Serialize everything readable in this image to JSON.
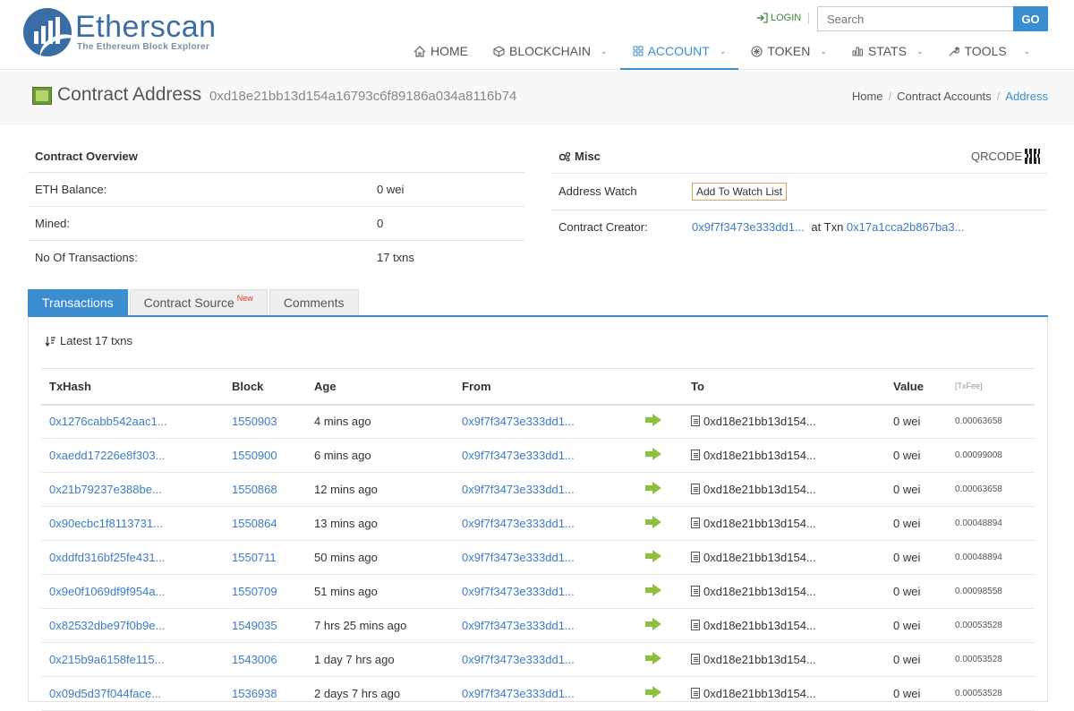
{
  "header": {
    "logo_title": "Etherscan",
    "logo_subtitle": "The Ethereum Block Explorer",
    "login_label": "LOGIN",
    "search_placeholder": "Search",
    "go_label": "GO",
    "nav": [
      {
        "label": "HOME",
        "icon": "home-icon"
      },
      {
        "label": "BLOCKCHAIN",
        "icon": "cube-icon"
      },
      {
        "label": "ACCOUNT",
        "icon": "grid-icon",
        "active": true
      },
      {
        "label": "TOKEN",
        "icon": "token-icon"
      },
      {
        "label": "STATS",
        "icon": "bar-chart-icon"
      },
      {
        "label": "TOOLS",
        "icon": "wrench-icon"
      }
    ]
  },
  "page": {
    "title": "Contract Address",
    "address": "0xd18e21bb13d154a16793c6f89186a034a8116b74",
    "breadcrumb": [
      "Home",
      "Contract Accounts",
      "Address"
    ]
  },
  "overview": {
    "title": "Contract Overview",
    "rows": [
      {
        "key": "ETH Balance:",
        "value": "0 wei"
      },
      {
        "key": "Mined:",
        "value": "0"
      },
      {
        "key": "No Of Transactions:",
        "value": "17 txns"
      }
    ]
  },
  "misc": {
    "title": "Misc",
    "qrcode_label": "QRCODE",
    "address_watch_label": "Address Watch",
    "watch_button": "Add To Watch List",
    "creator_label": "Contract Creator:",
    "creator_address": "0x9f7f3473e333dd1...",
    "at_txn_label": "at Txn",
    "creator_txn": "0x17a1cca2b867ba3..."
  },
  "tabs": {
    "transactions": "Transactions",
    "contract_source": "Contract Source",
    "new_badge": "New",
    "comments": "Comments"
  },
  "transactions": {
    "summary": "Latest 17 txns",
    "columns": [
      "TxHash",
      "Block",
      "Age",
      "From",
      "To",
      "Value",
      "[TxFee]"
    ],
    "rows": [
      {
        "hash": "0x1276cabb542aac1...",
        "block": "1550903",
        "age": "4 mins ago",
        "from": "0x9f7f3473e333dd1...",
        "to": "0xd18e21bb13d154...",
        "value": "0 wei",
        "fee": "0.00063658"
      },
      {
        "hash": "0xaedd17226e8f303...",
        "block": "1550900",
        "age": "6 mins ago",
        "from": "0x9f7f3473e333dd1...",
        "to": "0xd18e21bb13d154...",
        "value": "0 wei",
        "fee": "0.00099008"
      },
      {
        "hash": "0x21b79237e388be...",
        "block": "1550868",
        "age": "12 mins ago",
        "from": "0x9f7f3473e333dd1...",
        "to": "0xd18e21bb13d154...",
        "value": "0 wei",
        "fee": "0.00063658"
      },
      {
        "hash": "0x90ecbc1f8113731...",
        "block": "1550864",
        "age": "13 mins ago",
        "from": "0x9f7f3473e333dd1...",
        "to": "0xd18e21bb13d154...",
        "value": "0 wei",
        "fee": "0.00048894"
      },
      {
        "hash": "0xddfd316bf25fe431...",
        "block": "1550711",
        "age": "50 mins ago",
        "from": "0x9f7f3473e333dd1...",
        "to": "0xd18e21bb13d154...",
        "value": "0 wei",
        "fee": "0.00048894"
      },
      {
        "hash": "0x9e0f1069df9f954a...",
        "block": "1550709",
        "age": "51 mins ago",
        "from": "0x9f7f3473e333dd1...",
        "to": "0xd18e21bb13d154...",
        "value": "0 wei",
        "fee": "0.00098558"
      },
      {
        "hash": "0x82532dbe97f0b9e...",
        "block": "1549035",
        "age": "7 hrs 25 mins ago",
        "from": "0x9f7f3473e333dd1...",
        "to": "0xd18e21bb13d154...",
        "value": "0 wei",
        "fee": "0.00053528"
      },
      {
        "hash": "0x215b9a6158fe115...",
        "block": "1543006",
        "age": "1 day 7 hrs ago",
        "from": "0x9f7f3473e333dd1...",
        "to": "0xd18e21bb13d154...",
        "value": "0 wei",
        "fee": "0.00053528"
      },
      {
        "hash": "0x09d5d37f044face...",
        "block": "1536938",
        "age": "2 days 7 hrs ago",
        "from": "0x9f7f3473e333dd1...",
        "to": "0xd18e21bb13d154...",
        "value": "0 wei",
        "fee": "0.00053528"
      }
    ]
  }
}
